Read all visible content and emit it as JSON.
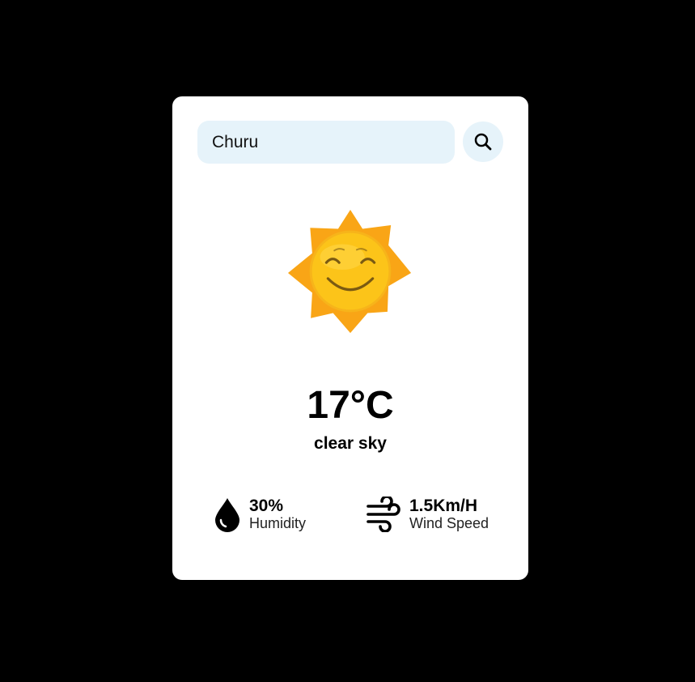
{
  "search": {
    "value": "Churu",
    "button_icon": "search-icon"
  },
  "weather": {
    "icon": "smiling-sun-icon",
    "temperature": "17°C",
    "description": "clear sky"
  },
  "stats": {
    "humidity": {
      "value": "30%",
      "label": "Humidity",
      "icon": "water-drop-icon"
    },
    "wind": {
      "value": "1.5Km/H",
      "label": "Wind Speed",
      "icon": "wind-icon"
    }
  },
  "colors": {
    "background": "#000000",
    "card": "#ffffff",
    "input_background": "#e6f3fa",
    "sun_rays": "#f9a516",
    "sun_face": "#fcc419"
  }
}
